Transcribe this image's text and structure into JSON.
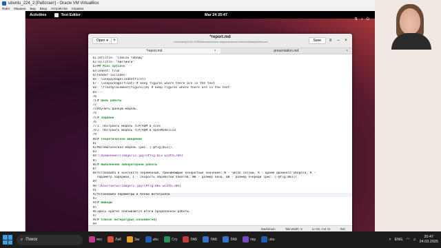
{
  "host_window": {
    "title": "ubuntu_224_2 [Работает] - Oracle VM VirtualBox",
    "menu": [
      "Файл",
      "Машина",
      "Вид",
      "Ввод",
      "Устройства",
      "Справка"
    ]
  },
  "guest_left_menu": [
    "Файл",
    "Машина",
    "Вид",
    "Ввод",
    "Устройства",
    "Справка"
  ],
  "gnome": {
    "activities": "Activities",
    "app_name": "Text Editor",
    "clock": "Mar 24 20:47"
  },
  "editor": {
    "open_label": "Open",
    "title": "*report.md",
    "subtitle": "~/work/study/2024-2025/Математическое моделирование/mathmod/labs/lab06/report",
    "save_label": "Save",
    "tabs": [
      {
        "label": "*report.md",
        "active": true
      },
      {
        "label": "presentation.md",
        "active": false
      }
    ],
    "lines": [
      {
        "n": "61",
        "t": "lotTitle: \"Список таблиц\"",
        "k": ""
      },
      {
        "n": "62",
        "t": "lolTitle: \"Листинги\"",
        "k": ""
      },
      {
        "n": "63",
        "t": "## Misc options",
        "k": "h"
      },
      {
        "n": "64",
        "t": "indent: true",
        "k": ""
      },
      {
        "n": "65",
        "t": "header-includes:",
        "k": ""
      },
      {
        "n": "66",
        "t": "  - \\usepackage{indentfirst}",
        "k": ""
      },
      {
        "n": "67",
        "t": "  - \\usepackage{float} # keep figures where there are in the text",
        "k": ""
      },
      {
        "n": "68",
        "t": "  - \\floatplacement{figure}{H} # keep figures where there are in the text",
        "k": ""
      },
      {
        "n": "69",
        "t": "---",
        "k": ""
      },
      {
        "n": "70",
        "t": "",
        "k": ""
      },
      {
        "n": "71",
        "t": "# Цель работы",
        "k": "h"
      },
      {
        "n": "72",
        "t": "",
        "k": ""
      },
      {
        "n": "73",
        "t": "Изучить данную модель.",
        "k": ""
      },
      {
        "n": "74",
        "t": "",
        "k": ""
      },
      {
        "n": "75",
        "t": "# Задание",
        "k": "h"
      },
      {
        "n": "76",
        "t": "",
        "k": ""
      },
      {
        "n": "77",
        "t": "1. Построить модель TCP/AQM в xcos",
        "k": ""
      },
      {
        "n": "78",
        "t": "2. Построить модель TCP/AQM в OpenModelica",
        "k": ""
      },
      {
        "n": "79",
        "t": "",
        "k": ""
      },
      {
        "n": "80",
        "t": "# Теоретическое введение",
        "k": "h"
      },
      {
        "n": "81",
        "t": "",
        "k": ""
      },
      {
        "n": "82",
        "t": "Математическая модель (рис. [-@fig:013]).",
        "k": ""
      },
      {
        "n": "83",
        "t": "",
        "k": ""
      },
      {
        "n": "84",
        "t": "![Уравнения](image/13.jpg){#fig:013 width=70%}",
        "k": "ref"
      },
      {
        "n": "85",
        "t": "",
        "k": ""
      },
      {
        "n": "86",
        "t": "# Выполнение лабораторной работы",
        "k": "h"
      },
      {
        "n": "87",
        "t": "",
        "k": ""
      },
      {
        "n": "88",
        "t": "Установила в контексте переменные, принимающие конкретные значения: N - число сессий, R - время двойного оборота, K -",
        "k": ""
      },
      {
        "n": "",
        "t": "  параметр задержки, C - скорость обработки пакетов, WB - размер окна, QB - размер очереди  (рис. [-@fig:001]).",
        "k": ""
      },
      {
        "n": "89",
        "t": "",
        "k": ""
      },
      {
        "n": "90",
        "t": "![Константы](image/1.jpg){#fig:001 width=70%}",
        "k": "ref"
      },
      {
        "n": "91",
        "t": "",
        "k": ""
      },
      {
        "n": "92",
        "t": "Установила параметры в блоки интегралов",
        "k": "cur"
      },
      {
        "n": "93",
        "t": "",
        "k": ""
      },
      {
        "n": "94",
        "t": "# Выводы",
        "k": "h"
      },
      {
        "n": "95",
        "t": "",
        "k": ""
      },
      {
        "n": "96",
        "t": "Здесь кратко описываются итоги проделанной работы.",
        "k": ""
      },
      {
        "n": "97",
        "t": "",
        "k": ""
      },
      {
        "n": "98",
        "t": "# Список литературы{.unnumbered}",
        "k": "h"
      },
      {
        "n": "99",
        "t": "",
        "k": ""
      }
    ],
    "status": {
      "language": "Markdown",
      "tab_width": "Tab Width: 8",
      "position": "Ln 92, Col 41",
      "mode": "INS"
    }
  },
  "taskbar": {
    "search_label": "Поиск",
    "apps": [
      {
        "label": "ясо",
        "color": "#c23b8a"
      },
      {
        "label": "Лаб",
        "color": "#d94f3a"
      },
      {
        "label": "Заг",
        "color": "#e6a02a"
      },
      {
        "label": "ubu",
        "color": "#1f5fad"
      },
      {
        "label": "Сту",
        "color": "#2a8f5a"
      },
      {
        "label": "ЛАБ",
        "color": "#c23b3b"
      },
      {
        "label": "ЛАБ",
        "color": "#3b73c2"
      },
      {
        "label": "ЛАБ",
        "color": "#3b73c2"
      },
      {
        "label": "mip",
        "color": "#7a4ac2"
      },
      {
        "label": "ubu",
        "color": "#1f5fad"
      }
    ],
    "lang": "ENG",
    "time": "20:47",
    "date": "24.03.2025"
  }
}
